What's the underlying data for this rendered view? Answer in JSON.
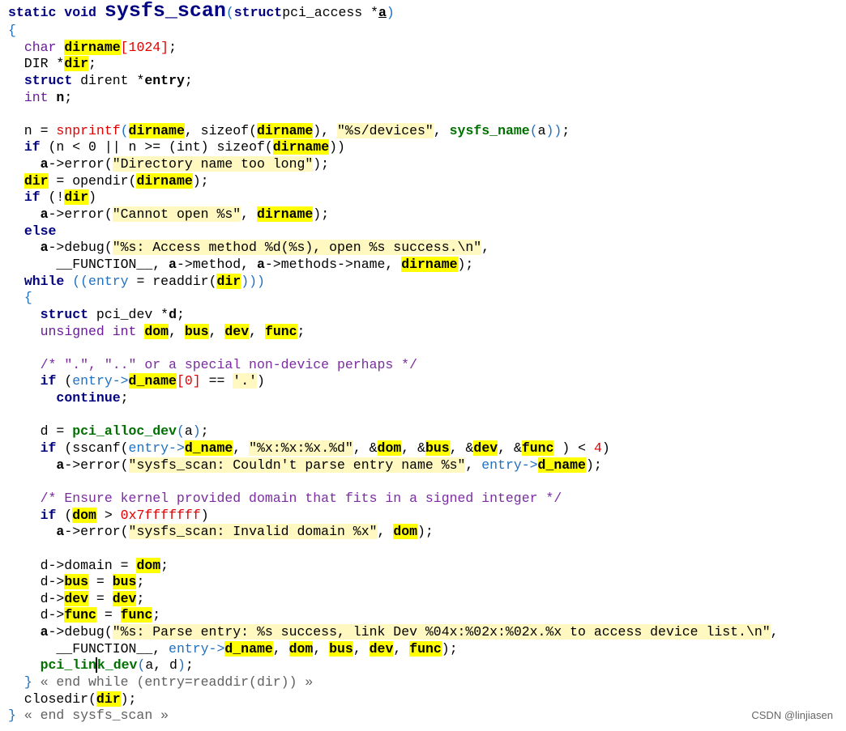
{
  "code_lines": [
    [
      [
        "kw",
        "static void "
      ],
      [
        "big",
        "sysfs_scan"
      ],
      [
        "p",
        "("
      ],
      [
        "kw",
        "struct"
      ],
      [
        "",
        "pci_access *"
      ],
      [
        "u",
        "a"
      ],
      [
        "p",
        ")"
      ]
    ],
    [
      [
        "p",
        "{"
      ]
    ],
    [
      [
        "",
        "  "
      ],
      [
        "t",
        "char "
      ],
      [
        "h",
        "dirname"
      ],
      [
        "f",
        "[1024]"
      ],
      [
        "",
        ";"
      ]
    ],
    [
      [
        "",
        "  DIR *"
      ],
      [
        "h",
        "dir"
      ],
      [
        "",
        ";"
      ]
    ],
    [
      [
        "",
        "  "
      ],
      [
        "kw",
        "struct"
      ],
      [
        "",
        " dirent *"
      ],
      [
        "b",
        "entry"
      ],
      [
        "",
        ";"
      ]
    ],
    [
      [
        "",
        "  "
      ],
      [
        "t",
        "int "
      ],
      [
        "b",
        "n"
      ],
      [
        "",
        ";"
      ]
    ],
    [
      [
        "",
        ""
      ]
    ],
    [
      [
        "",
        "  n = "
      ],
      [
        "f",
        "snprintf"
      ],
      [
        "p",
        "("
      ],
      [
        "h",
        "dirname"
      ],
      [
        "",
        ", sizeof("
      ],
      [
        "h",
        "dirname"
      ],
      [
        "",
        "), "
      ],
      [
        "s",
        "\"%s/devices\""
      ],
      [
        "",
        ", "
      ],
      [
        "fn",
        "sysfs_name"
      ],
      [
        "p",
        "("
      ],
      [
        "",
        "a"
      ],
      [
        "p",
        "))"
      ],
      [
        "",
        ";"
      ]
    ],
    [
      [
        "",
        "  "
      ],
      [
        "kw",
        "if"
      ],
      [
        "",
        " (n < 0 || n >= (int) sizeof("
      ],
      [
        "h",
        "dirname"
      ],
      [
        "",
        "))"
      ]
    ],
    [
      [
        "",
        "    "
      ],
      [
        "b",
        "a"
      ],
      [
        "",
        "->error("
      ],
      [
        "s",
        "\"Directory name too long\""
      ],
      [
        "",
        ");"
      ]
    ],
    [
      [
        "",
        "  "
      ],
      [
        "h",
        "dir"
      ],
      [
        "",
        " = opendir("
      ],
      [
        "h",
        "dirname"
      ],
      [
        "",
        ");"
      ]
    ],
    [
      [
        "",
        "  "
      ],
      [
        "kw",
        "if"
      ],
      [
        "",
        " (!"
      ],
      [
        "h",
        "dir"
      ],
      [
        "",
        ")"
      ]
    ],
    [
      [
        "",
        "    "
      ],
      [
        "b",
        "a"
      ],
      [
        "",
        "->error("
      ],
      [
        "s",
        "\"Cannot open %s\""
      ],
      [
        "",
        ", "
      ],
      [
        "h",
        "dirname"
      ],
      [
        "",
        ");"
      ]
    ],
    [
      [
        "",
        "  "
      ],
      [
        "kw",
        "else"
      ]
    ],
    [
      [
        "",
        "    "
      ],
      [
        "b",
        "a"
      ],
      [
        "",
        "->debug("
      ],
      [
        "s",
        "\"%s: Access method %d(%s), open %s success.\\n\""
      ],
      [
        "",
        ","
      ]
    ],
    [
      [
        "",
        "      __FUNCTION__, "
      ],
      [
        "b",
        "a"
      ],
      [
        "",
        "->method, "
      ],
      [
        "b",
        "a"
      ],
      [
        "",
        "->methods->name, "
      ],
      [
        "h",
        "dirname"
      ],
      [
        "",
        ");"
      ]
    ],
    [
      [
        "",
        "  "
      ],
      [
        "kw",
        "while"
      ],
      [
        "p",
        " (("
      ],
      [
        "p",
        "entry"
      ],
      [
        "",
        " = readdir("
      ],
      [
        "h",
        "dir"
      ],
      [
        "p",
        "))"
      ],
      [
        "p",
        ")"
      ]
    ],
    [
      [
        "",
        "  "
      ],
      [
        "p",
        "{"
      ]
    ],
    [
      [
        "",
        "    "
      ],
      [
        "kw",
        "struct"
      ],
      [
        "",
        " pci_dev *"
      ],
      [
        "b",
        "d"
      ],
      [
        "",
        ";"
      ]
    ],
    [
      [
        "",
        "    "
      ],
      [
        "t",
        "unsigned int "
      ],
      [
        "h",
        "dom"
      ],
      [
        "",
        ", "
      ],
      [
        "h",
        "bus"
      ],
      [
        "",
        ", "
      ],
      [
        "h",
        "dev"
      ],
      [
        "",
        ", "
      ],
      [
        "h",
        "func"
      ],
      [
        "",
        ";"
      ]
    ],
    [
      [
        "",
        ""
      ]
    ],
    [
      [
        "",
        "    "
      ],
      [
        "c",
        "/* \".\", \"..\" or a special non-device perhaps */"
      ]
    ],
    [
      [
        "",
        "    "
      ],
      [
        "kw",
        "if"
      ],
      [
        "",
        " ("
      ],
      [
        "p",
        "entry->"
      ],
      [
        "h",
        "d_name"
      ],
      [
        "f",
        "[0]"
      ],
      [
        "",
        " == "
      ],
      [
        "s",
        "'.'"
      ],
      [
        "",
        ")"
      ]
    ],
    [
      [
        "",
        "      "
      ],
      [
        "kw",
        "continue"
      ],
      [
        "",
        ";"
      ]
    ],
    [
      [
        "",
        ""
      ]
    ],
    [
      [
        "",
        "    d = "
      ],
      [
        "fn",
        "pci_alloc_dev"
      ],
      [
        "p",
        "("
      ],
      [
        "",
        "a"
      ],
      [
        "p",
        ")"
      ],
      [
        "",
        ";"
      ]
    ],
    [
      [
        "",
        "    "
      ],
      [
        "kw",
        "if"
      ],
      [
        "",
        " (sscanf("
      ],
      [
        "p",
        "entry->"
      ],
      [
        "h",
        "d_name"
      ],
      [
        "",
        ", "
      ],
      [
        "s",
        "\"%x:%x:%x.%d\""
      ],
      [
        "",
        ", &"
      ],
      [
        "h",
        "dom"
      ],
      [
        "",
        ", &"
      ],
      [
        "h",
        "bus"
      ],
      [
        "",
        ", &"
      ],
      [
        "h",
        "dev"
      ],
      [
        "",
        ", &"
      ],
      [
        "h",
        "func"
      ],
      [
        "",
        " ) < "
      ],
      [
        "n",
        "4"
      ],
      [
        "",
        ")"
      ]
    ],
    [
      [
        "",
        "      "
      ],
      [
        "b",
        "a"
      ],
      [
        "",
        "->error("
      ],
      [
        "s",
        "\"sysfs_scan: Couldn't parse entry name %s\""
      ],
      [
        "",
        ", "
      ],
      [
        "p",
        "entry->"
      ],
      [
        "h",
        "d_name"
      ],
      [
        "",
        ");"
      ]
    ],
    [
      [
        "",
        ""
      ]
    ],
    [
      [
        "",
        "    "
      ],
      [
        "c",
        "/* Ensure kernel provided domain that fits in a signed integer */"
      ]
    ],
    [
      [
        "",
        "    "
      ],
      [
        "kw",
        "if"
      ],
      [
        "",
        " ("
      ],
      [
        "h",
        "dom"
      ],
      [
        "",
        " > "
      ],
      [
        "n",
        "0x7fffffff"
      ],
      [
        "",
        ")"
      ]
    ],
    [
      [
        "",
        "      "
      ],
      [
        "b",
        "a"
      ],
      [
        "",
        "->error("
      ],
      [
        "s",
        "\"sysfs_scan: Invalid domain %x\""
      ],
      [
        "",
        ", "
      ],
      [
        "h",
        "dom"
      ],
      [
        "",
        ");"
      ]
    ],
    [
      [
        "",
        ""
      ]
    ],
    [
      [
        "",
        "    d->domain = "
      ],
      [
        "h",
        "dom"
      ],
      [
        "",
        ";"
      ]
    ],
    [
      [
        "",
        "    d->"
      ],
      [
        "h",
        "bus"
      ],
      [
        "",
        " = "
      ],
      [
        "h",
        "bus"
      ],
      [
        "",
        ";"
      ]
    ],
    [
      [
        "",
        "    d->"
      ],
      [
        "h",
        "dev"
      ],
      [
        "",
        " = "
      ],
      [
        "h",
        "dev"
      ],
      [
        "",
        ";"
      ]
    ],
    [
      [
        "",
        "    d->"
      ],
      [
        "h",
        "func"
      ],
      [
        "",
        " = "
      ],
      [
        "h",
        "func"
      ],
      [
        "",
        ";"
      ]
    ],
    [
      [
        "",
        "    "
      ],
      [
        "b",
        "a"
      ],
      [
        "",
        "->debug("
      ],
      [
        "s",
        "\"%s: Parse entry: %s success, link Dev %04x:%02x:%02x.%x to access device list.\\n\""
      ],
      [
        "",
        ","
      ]
    ],
    [
      [
        "",
        "      __FUNCTION__, "
      ],
      [
        "p",
        "entry->"
      ],
      [
        "h",
        "d_name"
      ],
      [
        "",
        ", "
      ],
      [
        "h",
        "dom"
      ],
      [
        "",
        ", "
      ],
      [
        "h",
        "bus"
      ],
      [
        "",
        ", "
      ],
      [
        "h",
        "dev"
      ],
      [
        "",
        ", "
      ],
      [
        "h",
        "func"
      ],
      [
        "",
        ");"
      ]
    ],
    [
      [
        "",
        "    "
      ],
      [
        "fn",
        "pci_lin"
      ],
      [
        "cur",
        ""
      ],
      [
        "fn",
        "k_dev"
      ],
      [
        "p",
        "("
      ],
      [
        "",
        "a, d"
      ],
      [
        "p",
        ")"
      ],
      [
        "",
        ";"
      ]
    ],
    [
      [
        "",
        "  "
      ],
      [
        "p",
        "}"
      ],
      [
        "fold",
        " « end while (entry=readdir(dir)) »"
      ]
    ],
    [
      [
        "",
        "  closedir("
      ],
      [
        "h",
        "dir"
      ],
      [
        "",
        ");"
      ]
    ],
    [
      [
        "p",
        "}"
      ],
      [
        "fold",
        " « end sysfs_scan »"
      ]
    ]
  ],
  "watermark": "CSDN @linjiasen"
}
